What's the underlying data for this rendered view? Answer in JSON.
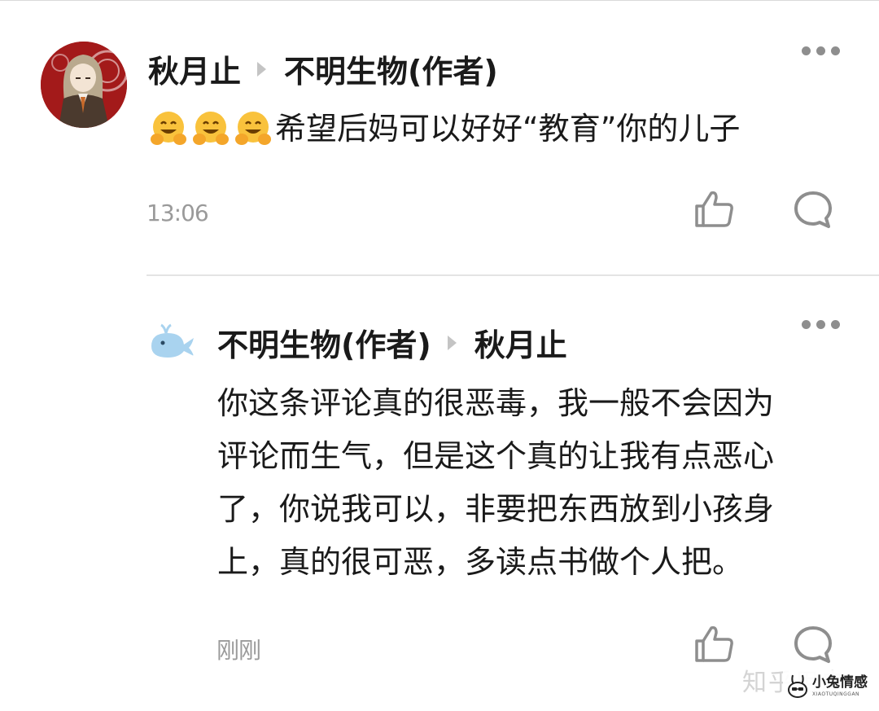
{
  "comment": {
    "author": "秋月止",
    "reply_to": "不明生物(作者)",
    "emojis": [
      "hug-emoji",
      "hug-emoji",
      "hug-emoji"
    ],
    "text": "希望后妈可以好好“教育”你的儿子",
    "time": "13:06",
    "icons": {
      "more": "more-dots-icon",
      "like": "thumbs-up-icon",
      "reply": "comment-bubble-icon"
    }
  },
  "reply": {
    "author": "不明生物(作者)",
    "reply_to": "秋月止",
    "lines": [
      "你这条评论真的很恶毒，我一般不会因为",
      "评论而生气，但是这个真的让我有点恶心",
      "了，你说我可以，非要把东西放到小孩身",
      "上，真的很可恶，多读点书做个人把。"
    ],
    "time": "刚刚",
    "icons": {
      "more": "more-dots-icon",
      "like": "thumbs-up-icon",
      "reply": "comment-bubble-icon"
    }
  },
  "watermark": {
    "platform": "知乎用户",
    "brand": "小兔情感",
    "brand_sub": "XIAOTUQINGGAN"
  },
  "colors": {
    "text": "#1a1a1a",
    "meta": "#9a9a9a",
    "icon": "#8e8e8e",
    "divider": "#e4e4e4",
    "avatar_bg": "#a01818"
  }
}
